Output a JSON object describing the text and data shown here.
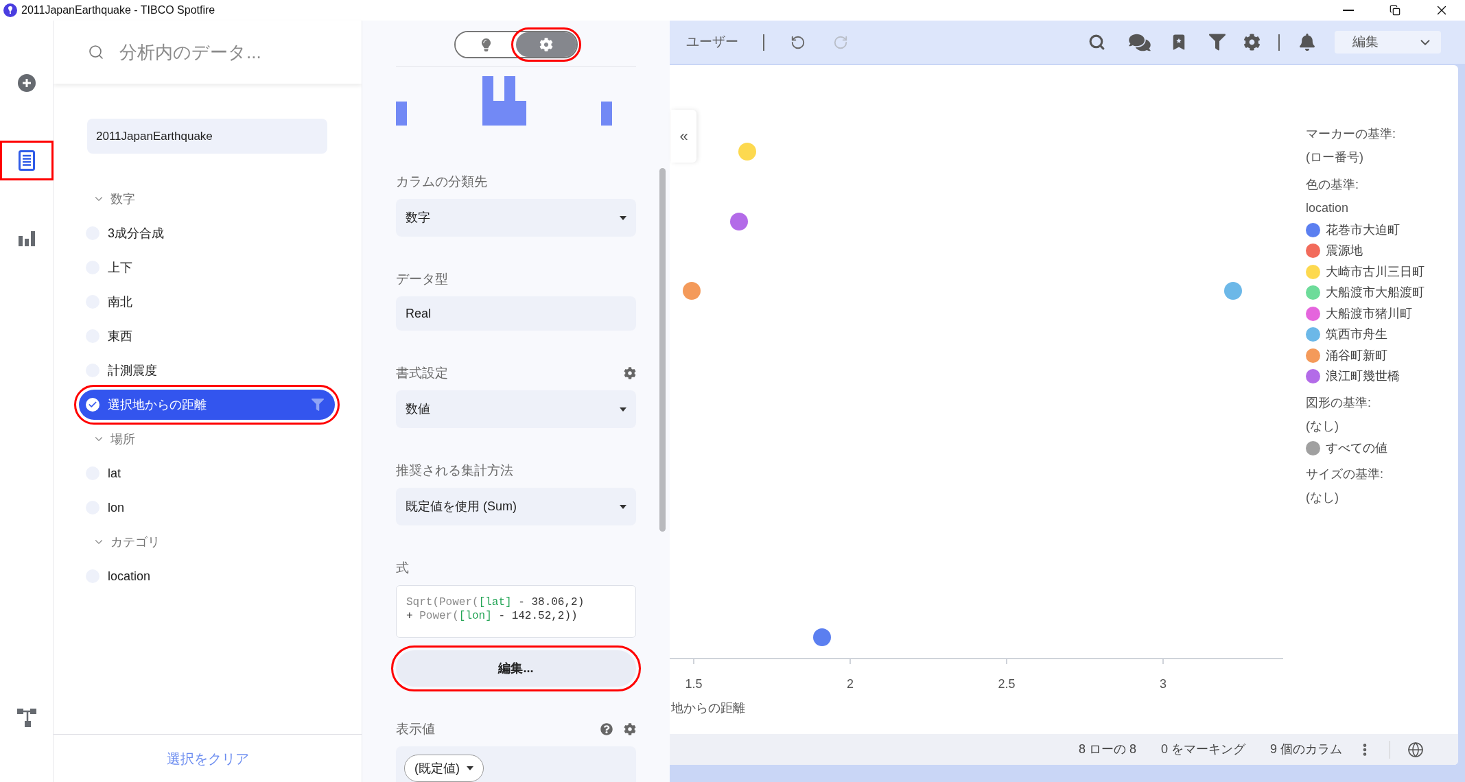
{
  "title_bar": {
    "title": "2011JapanEarthquake - TIBCO Spotfire"
  },
  "rail": {
    "items": [
      {
        "kind": "add",
        "selected": false,
        "annotated": false
      },
      {
        "kind": "data",
        "selected": true,
        "annotated": true
      },
      {
        "kind": "visualizations",
        "selected": false,
        "annotated": false
      }
    ],
    "bottom_items": [
      {
        "kind": "data-canvas",
        "selected": false,
        "annotated": false
      }
    ]
  },
  "data_panel": {
    "search": {
      "placeholder": "分析内のデータ..."
    },
    "dataset": "2011JapanEarthquake",
    "groups": [
      {
        "label": "数字",
        "expanded": true,
        "children": [
          {
            "label": "3成分合成",
            "selected": false,
            "annotated": false
          },
          {
            "label": "上下",
            "selected": false,
            "annotated": false
          },
          {
            "label": "南北",
            "selected": false,
            "annotated": false
          },
          {
            "label": "東西",
            "selected": false,
            "annotated": false
          },
          {
            "label": "計測震度",
            "selected": false,
            "annotated": false
          },
          {
            "label": "選択地からの距離",
            "selected": true,
            "annotated": true
          }
        ]
      },
      {
        "label": "場所",
        "expanded": true,
        "children": [
          {
            "label": "lat",
            "selected": false,
            "annotated": false
          },
          {
            "label": "lon",
            "selected": false,
            "annotated": false
          }
        ]
      },
      {
        "label": "カテゴリ",
        "expanded": true,
        "children": [
          {
            "label": "location",
            "selected": false,
            "annotated": false
          }
        ]
      }
    ],
    "clear_button": "選択をクリア"
  },
  "props_panel": {
    "toggle": [
      {
        "kind": "insights",
        "selected": false,
        "annotated": false
      },
      {
        "kind": "settings",
        "selected": true,
        "annotated": true
      }
    ],
    "collapse_button": "«",
    "sections": [
      {
        "kind": "dropdown",
        "label": "カラムの分類先",
        "value": "数字"
      },
      {
        "kind": "field",
        "label": "データ型",
        "value": "Real"
      },
      {
        "kind": "dropdown",
        "label": "書式設定",
        "value": "数値",
        "settings_icon": true
      },
      {
        "kind": "dropdown",
        "label": "推奨される集計方法",
        "value": "既定値を使用 (Sum)"
      },
      {
        "kind": "formula",
        "label": "式",
        "lines": [
          [
            {
              "kind": "function",
              "text": "Sqrt(Power("
            },
            {
              "kind": "field",
              "text": "[lat]"
            },
            {
              "kind": "text",
              "text": " - 38.06,2)"
            }
          ],
          [
            {
              "kind": "text",
              "text": "+ "
            },
            {
              "kind": "function",
              "text": "Power("
            },
            {
              "kind": "field",
              "text": "[lon]"
            },
            {
              "kind": "text",
              "text": " - 142.52,2))"
            }
          ]
        ],
        "button": {
          "label": "編集...",
          "annotated": true
        }
      },
      {
        "kind": "chip",
        "label": "表示値",
        "value": "(既定値)",
        "help_icon": true,
        "settings_icon": true
      }
    ]
  },
  "toolbar": {
    "user_label": "ユーザー",
    "undo": {
      "disabled": false
    },
    "redo": {
      "disabled": true
    },
    "mode": "編集"
  },
  "chart": {
    "x_axis": {
      "ticks": [
        "1.5",
        "2",
        "2.5",
        "3"
      ],
      "title": "地からの距離"
    },
    "legend": [
      {
        "kind": "heading",
        "text": "マーカーの基準:"
      },
      {
        "kind": "value",
        "text": "(ロー番号)"
      },
      {
        "kind": "heading",
        "text": "色の基準:"
      },
      {
        "kind": "value",
        "text": "location"
      },
      {
        "kind": "swatch",
        "text": "花巻市大迫町",
        "color": "#5b7ff0"
      },
      {
        "kind": "swatch",
        "text": "震源地",
        "color": "#f26b5b"
      },
      {
        "kind": "swatch",
        "text": "大崎市古川三日町",
        "color": "#fdd94f"
      },
      {
        "kind": "swatch",
        "text": "大船渡市大船渡町",
        "color": "#6ddc9a"
      },
      {
        "kind": "swatch",
        "text": "大船渡市猪川町",
        "color": "#e565dd"
      },
      {
        "kind": "swatch",
        "text": "筑西市舟生",
        "color": "#6cb8e8"
      },
      {
        "kind": "swatch",
        "text": "涌谷町新町",
        "color": "#f49a5a"
      },
      {
        "kind": "swatch",
        "text": "浪江町幾世橋",
        "color": "#b36be8"
      },
      {
        "kind": "heading",
        "text": "図形の基準:"
      },
      {
        "kind": "value",
        "text": "(なし)"
      },
      {
        "kind": "swatch",
        "text": "すべての値",
        "color": "#a0a0a0"
      },
      {
        "kind": "heading",
        "text": "サイズの基準:"
      },
      {
        "kind": "value",
        "text": "(なし)"
      }
    ]
  },
  "status_bar": {
    "items": [
      "8 ローの 8",
      "0 をマーキング",
      "9 個のカラム"
    ]
  }
}
